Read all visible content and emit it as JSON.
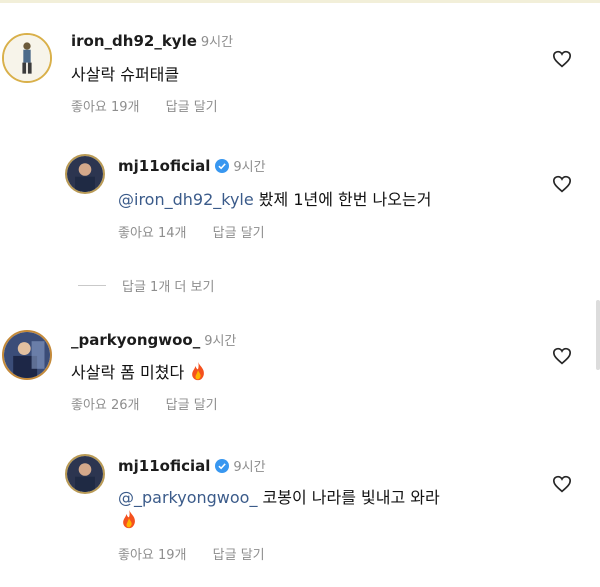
{
  "comments": [
    {
      "username": "iron_dh92_kyle",
      "time": "9시간",
      "text": "사살락 슈퍼태클",
      "likes": "좋아요 19개",
      "reply_label": "답글 달기"
    },
    {
      "username": "mj11oficial",
      "time": "9시간",
      "mention": "@iron_dh92_kyle",
      "text": " 봤제 1년에 한번 나오는거",
      "likes": "좋아요 14개",
      "reply_label": "답글 달기"
    },
    {
      "username": "_parkyongwoo_",
      "time": "9시간",
      "text": "사살락 폼 미쳤다",
      "likes": "좋아요 26개",
      "reply_label": "답글 달기"
    },
    {
      "username": "mj11oficial",
      "time": "9시간",
      "mention": "@_parkyongwoo_",
      "text": " 코봉이 나라를 빛내고 와라",
      "likes": "좋아요 19개",
      "reply_label": "답글 달기"
    }
  ],
  "view_more_replies": "답글 1개 더 보기",
  "icons": {
    "like": "heart-outline-icon",
    "verified": "verified-badge-icon",
    "fire": "fire-emoji"
  },
  "colors": {
    "mention": "#3b5b8a",
    "verified": "#3897f0",
    "meta": "#8e8e8e"
  }
}
